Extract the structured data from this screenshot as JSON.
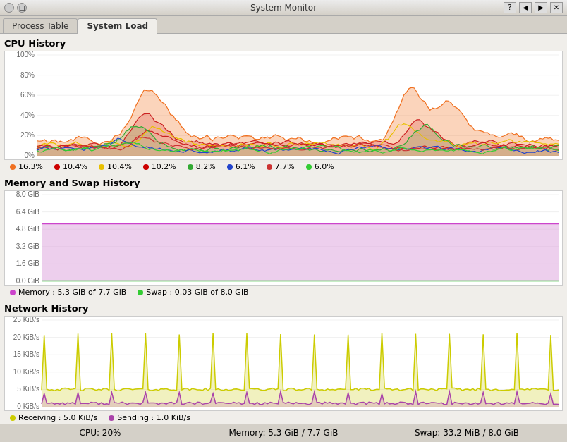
{
  "titleBar": {
    "title": "System Monitor",
    "buttons": [
      "minimize",
      "maximize",
      "close"
    ],
    "helpBtn": "?",
    "winBtns": [
      "_",
      "□",
      "×"
    ]
  },
  "tabs": [
    {
      "label": "Process Table",
      "active": false
    },
    {
      "label": "System Load",
      "active": true
    }
  ],
  "cpuSection": {
    "title": "CPU History",
    "yLabels": [
      "100%",
      "80%",
      "60%",
      "40%",
      "20%",
      "0%"
    ],
    "legend": [
      {
        "color": "#f07020",
        "text": "16.3%"
      },
      {
        "color": "#cc0000",
        "text": "10.4%"
      },
      {
        "color": "#e8c000",
        "text": "10.4%"
      },
      {
        "color": "#cc0000",
        "text": "10.2%"
      },
      {
        "color": "#33aa33",
        "text": "8.2%"
      },
      {
        "color": "#2244cc",
        "text": "6.1%"
      },
      {
        "color": "#cc3333",
        "text": "7.7%"
      },
      {
        "color": "#33cc33",
        "text": "6.0%"
      }
    ]
  },
  "memSection": {
    "title": "Memory and Swap History",
    "yLabels": [
      "8.0 GiB",
      "6.4 GiB",
      "4.8 GiB",
      "3.2 GiB",
      "1.6 GiB",
      "0.0 GiB"
    ],
    "legend": [
      {
        "color": "#cc44cc",
        "text": "Memory : 5.3 GiB of 7.7 GiB"
      },
      {
        "color": "#33cc33",
        "text": "Swap : 0.03 GiB of 8.0 GiB"
      }
    ]
  },
  "netSection": {
    "title": "Network History",
    "yLabels": [
      "25 KiB/s",
      "20 KiB/s",
      "15 KiB/s",
      "10 KiB/s",
      "5 KiB/s",
      "0 KiB/s"
    ],
    "legend": [
      {
        "color": "#cccc00",
        "text": "Receiving : 5.0 KiB/s"
      },
      {
        "color": "#aa44aa",
        "text": "Sending : 1.0 KiB/s"
      }
    ]
  },
  "statusBar": {
    "cpu": "CPU: 20%",
    "memory": "Memory: 5.3 GiB / 7.7 GiB",
    "swap": "Swap: 33.2 MiB / 8.0 GiB"
  }
}
